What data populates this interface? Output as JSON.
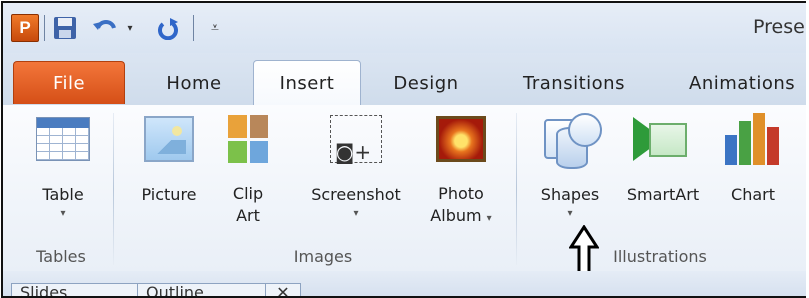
{
  "quick_access": {
    "app_badge": "P",
    "icons": [
      "save-icon",
      "undo-icon",
      "dropdown-icon",
      "redo-icon",
      "customize-menu-icon"
    ],
    "dropdown_glyph": "▾",
    "menu_glyph": "⩡"
  },
  "window": {
    "title": "Prese"
  },
  "tabs": [
    {
      "label": "File"
    },
    {
      "label": "Home"
    },
    {
      "label": "Insert"
    },
    {
      "label": "Design"
    },
    {
      "label": "Transitions"
    },
    {
      "label": "Animations"
    }
  ],
  "active_tab": "Insert",
  "groups": {
    "tables": {
      "label": "Tables",
      "buttons": [
        {
          "label": "Table",
          "caret": "▾"
        }
      ]
    },
    "images": {
      "label": "Images",
      "buttons": [
        {
          "label": "Picture"
        },
        {
          "label_line1": "Clip",
          "label_line2": "Art"
        },
        {
          "label": "Screenshot",
          "caret": "▾"
        },
        {
          "label_line1": "Photo",
          "label_line2": "Album",
          "caret": "▾"
        }
      ]
    },
    "illustrations": {
      "label": "Illustrations",
      "buttons": [
        {
          "label": "Shapes",
          "caret": "▾"
        },
        {
          "label": "SmartArt"
        },
        {
          "label": "Chart"
        }
      ]
    }
  },
  "bottom_tabs": [
    {
      "label": "Slides"
    },
    {
      "label": "Outline"
    }
  ],
  "colors": {
    "file_tab": "#d9541c",
    "accent_blue": "#4a7cc0",
    "ribbon_bg": "#f3f6fb"
  }
}
